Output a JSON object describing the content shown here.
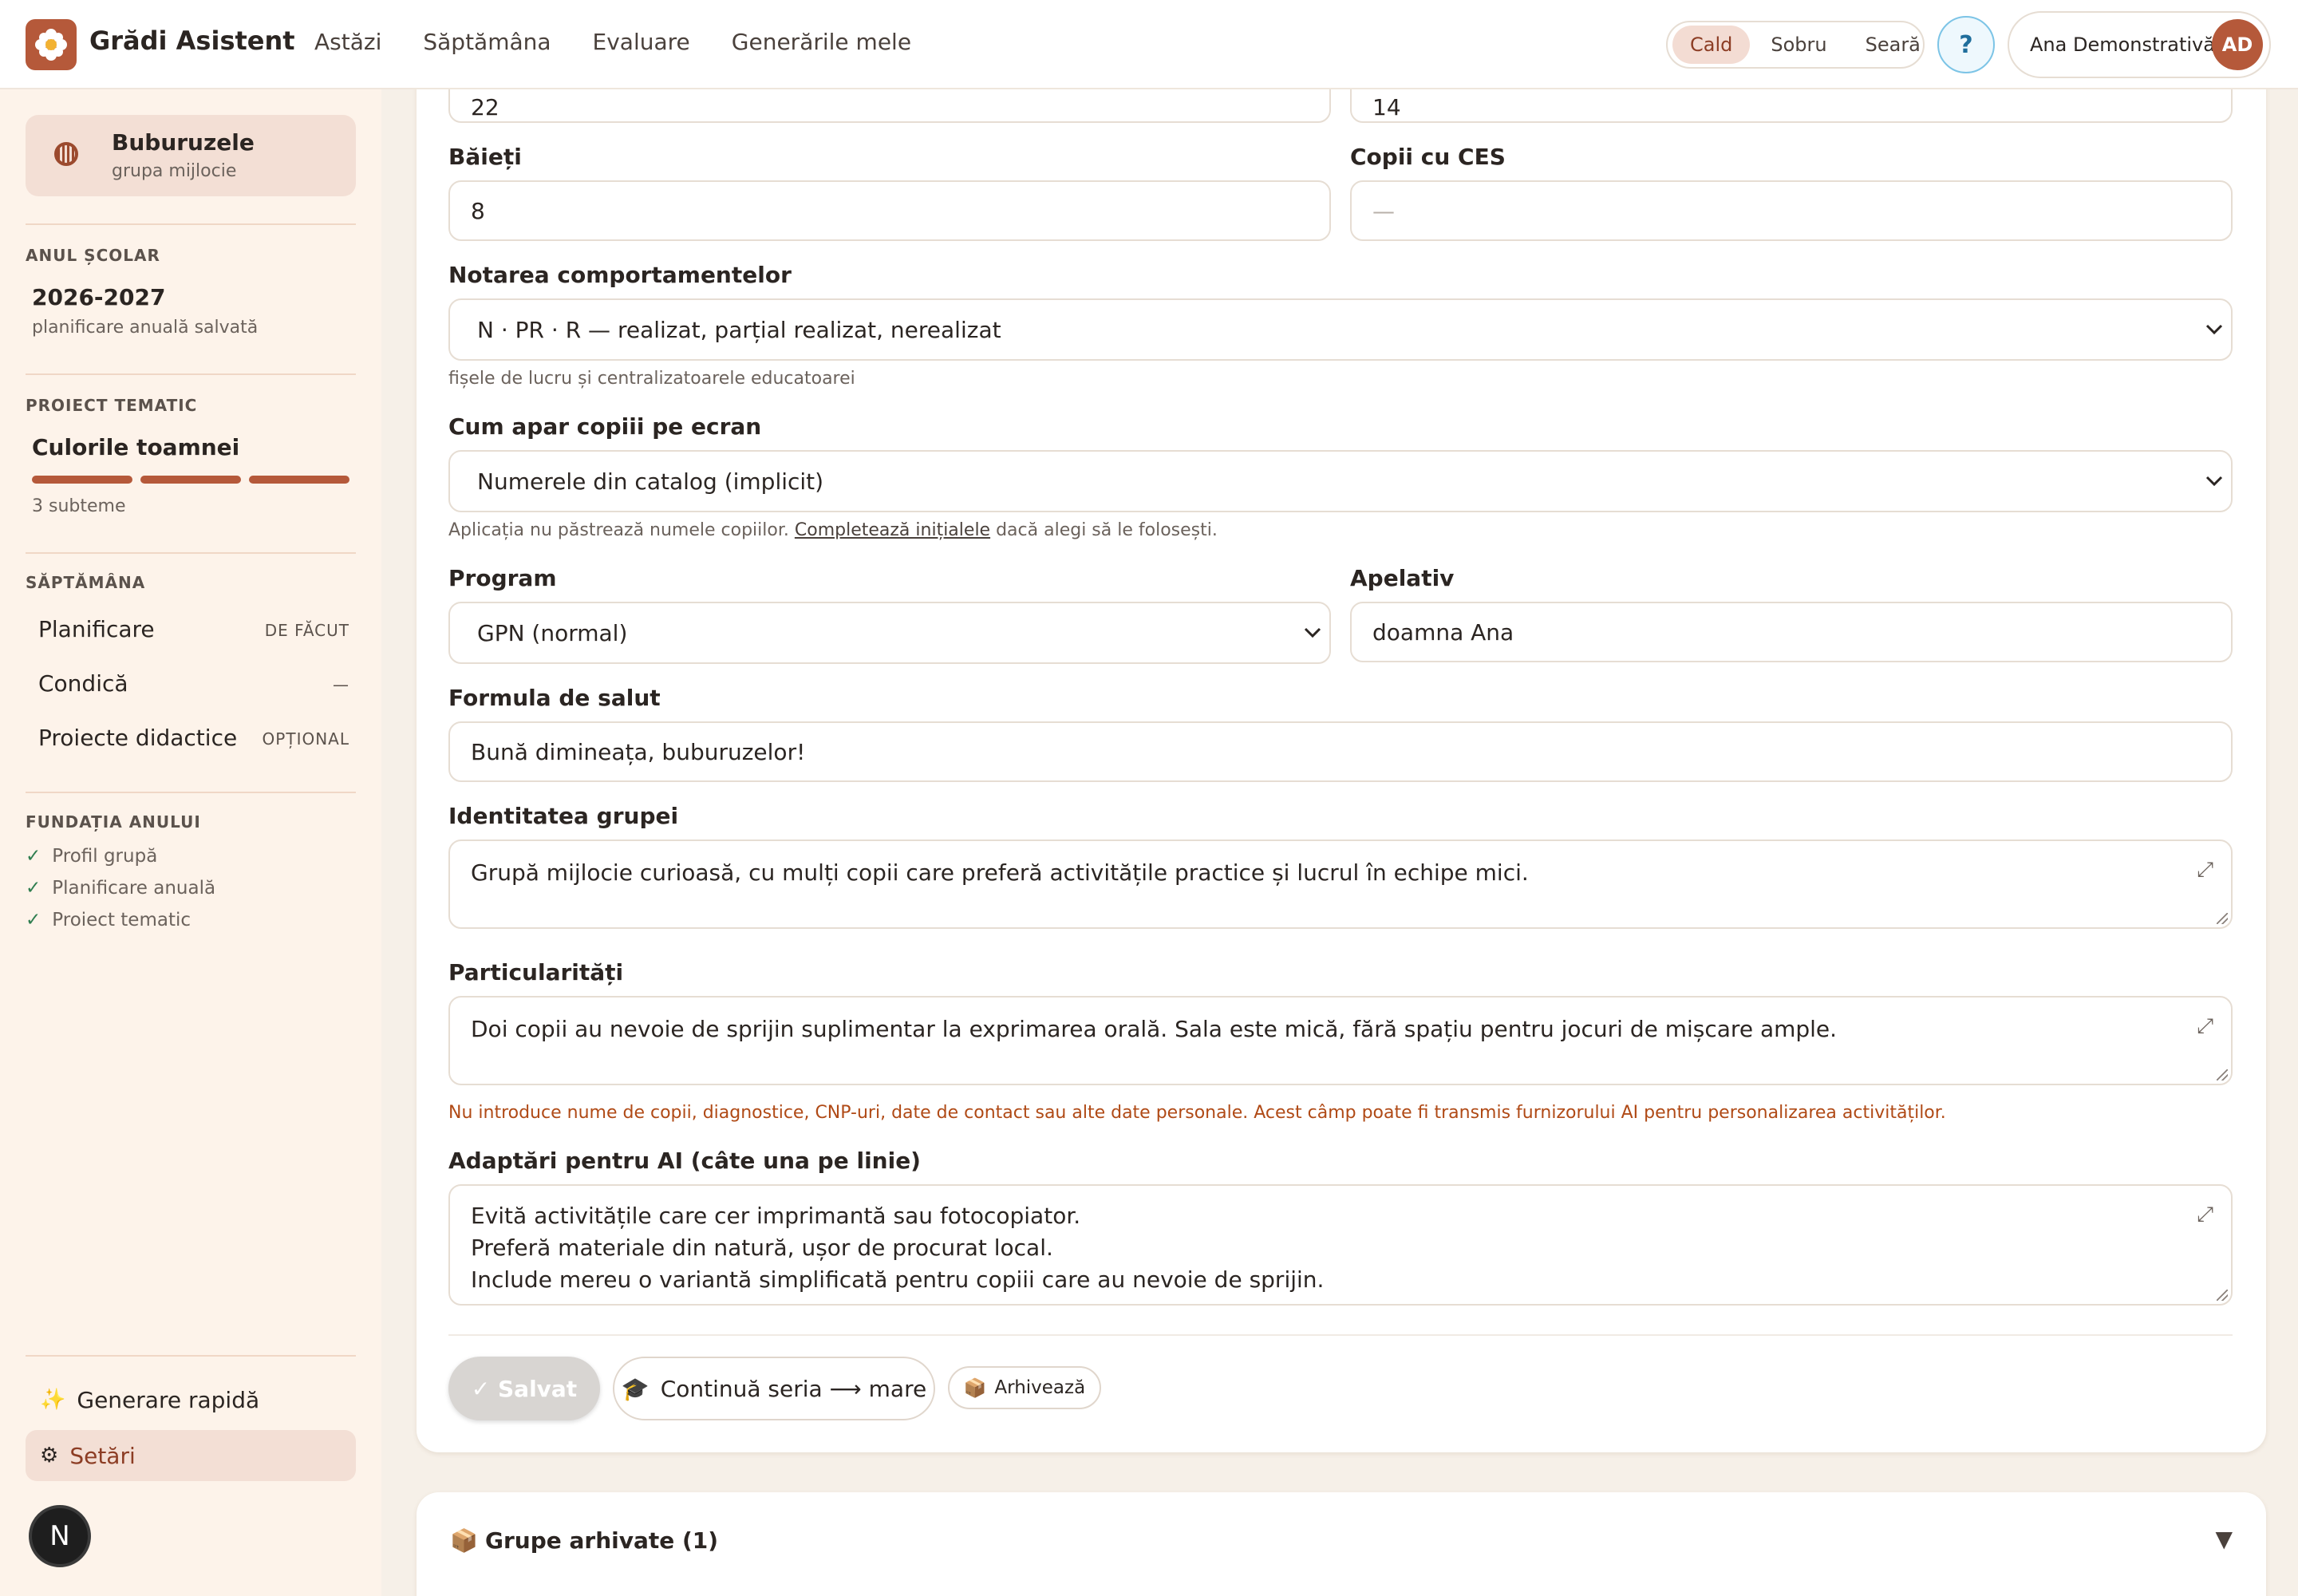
{
  "header": {
    "app_title": "Grădi Asistent",
    "nav": [
      "Astăzi",
      "Săptămâna",
      "Evaluare",
      "Generările mele"
    ],
    "theme_options": [
      "Cald",
      "Sobru",
      "Seară"
    ],
    "theme_active": "Cald",
    "help_label": "?",
    "user_name": "Ana Demonstrativă",
    "user_initials": "AD"
  },
  "sidebar": {
    "group": {
      "name": "Buburuzele",
      "subtitle": "grupa mijlocie"
    },
    "school_year": {
      "label": "ANUL ȘCOLAR",
      "value": "2026-2027",
      "note": "planificare anuală salvată"
    },
    "project": {
      "label": "PROIECT TEMATIC",
      "name": "Culorile toamnei",
      "subthemes": "3 subteme",
      "progress_segments": 3
    },
    "week": {
      "label": "SĂPTĂMÂNA",
      "items": [
        {
          "label": "Planificare",
          "status": "DE FĂCUT"
        },
        {
          "label": "Condică",
          "status": "—"
        },
        {
          "label": "Proiecte didactice",
          "status": "OPȚIONAL"
        }
      ]
    },
    "foundation": {
      "label": "FUNDAȚIA ANULUI",
      "items": [
        "Profil grupă",
        "Planificare anuală",
        "Proiect tematic"
      ]
    },
    "quick_generate": "Generare rapidă",
    "settings": "Setări",
    "n_badge": "N"
  },
  "form": {
    "partial_top_left_value": "22",
    "partial_top_right_value": "14",
    "boys_label": "Băieți",
    "boys_value": "8",
    "ces_label": "Copii cu CES",
    "ces_placeholder": "—",
    "behavior_label": "Notarea comportamentelor",
    "behavior_value": "N · PR · R — realizat, parțial realizat, nerealizat",
    "behavior_hint": "fișele de lucru și centralizatoarele educatoarei",
    "display_label": "Cum apar copiii pe ecran",
    "display_value": "Numerele din catalog (implicit)",
    "display_hint_before": "Aplicația nu păstrează numele copiilor.",
    "display_hint_link": "Completează inițialele",
    "display_hint_after": "dacă alegi să le folosești.",
    "program_label": "Program",
    "program_value": "GPN (normal)",
    "address_label": "Apelativ",
    "address_value": "doamna Ana",
    "greeting_label": "Formula de salut",
    "greeting_value": "Bună dimineața, buburuzelor!",
    "identity_label": "Identitatea grupei",
    "identity_value": "Grupă mijlocie curioasă, cu mulți copii care preferă activitățile practice și lucrul în echipe mici.",
    "particular_label": "Particularități",
    "particular_value": "Doi copii au nevoie de sprijin suplimentar la exprimarea orală. Sala este mică, fără spațiu pentru jocuri de mișcare ample.",
    "privacy_warning": "Nu introduce nume de copii, diagnostice, CNP-uri, date de contact sau alte date personale. Acest câmp poate fi transmis furnizorului AI pentru personalizarea activităților.",
    "ai_label": "Adaptări pentru AI (câte una pe linie)",
    "ai_lines": [
      "Evită activitățile care cer imprimantă sau fotocopiator.",
      "Preferă materiale din natură, ușor de procurat local.",
      "Include mereu o variantă simplificată pentru copiii care au nevoie de sprijin."
    ],
    "btn_saved": "✓ Salvat",
    "btn_continue": "Continuă seria ⟶ mare",
    "btn_archive": "Arhivează"
  },
  "archived": {
    "title": "Grupe arhivate (1)",
    "toggle": "▼"
  },
  "colors": {
    "accent": "#b5593a",
    "accent_soft": "#f3dfd5",
    "warning": "#b04a16",
    "success": "#2e7d4f"
  },
  "icons": {
    "logo": "flower-icon",
    "group": "ladybug-icon",
    "quick_generate": "sparkles-icon",
    "settings": "gear-icon",
    "continue": "graduation-cap-icon",
    "archive": "box-icon",
    "expand": "expand-icon",
    "dropdown": "chevron-down-icon"
  }
}
